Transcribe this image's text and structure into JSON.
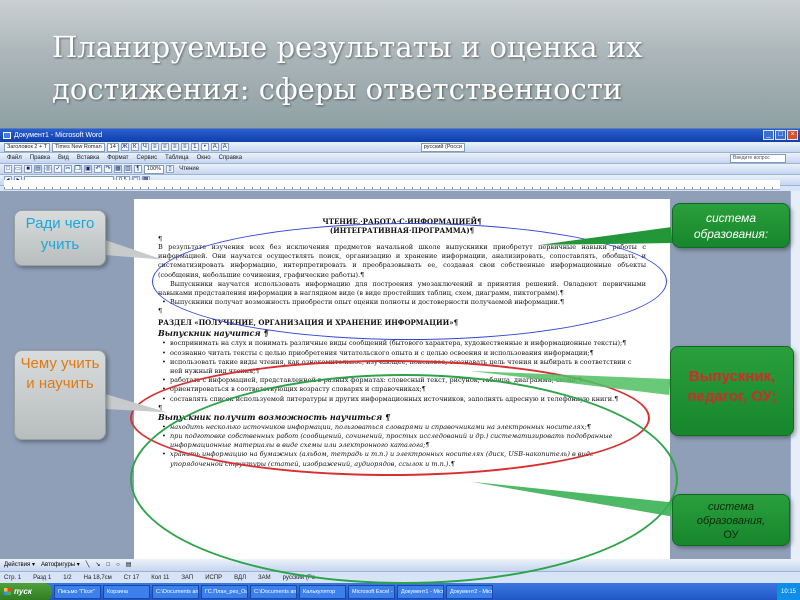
{
  "slide": {
    "title": "Планируемые результаты и оценка их достижения: сферы ответственности"
  },
  "word": {
    "window_title": "Документ1 - Microsoft Word",
    "style": "Заголовок 2 + Т",
    "font": "Times New Roman",
    "font_size": "14",
    "language": "русский (Росси",
    "zoom": "100%",
    "reading_label": "Чтение",
    "help_placeholder": "Введите вопрос",
    "indent_value": "0,5",
    "menu": [
      "Файл",
      "Правка",
      "Вид",
      "Вставка",
      "Формат",
      "Сервис",
      "Таблица",
      "Окно",
      "Справка"
    ],
    "document": {
      "heading_1": "ЧТЕНИЕ.·РАБОТА·С·ИНФОРМАЦИЕЙ¶",
      "heading_2": "(ИНТЕГРАТИВНАЯ·ПРОГРАММА)¶",
      "para_1": "В результате изучения всех без исключения предметов начальной школе выпускники приобретут первичные навыки работы с информацией. Они научатся осуществлять поиск, организацию и хранение информации, анализировать, сопоставлять, обобщать, и систематизировать информацию, интерпретировать и преобразовывать ее, создавая свои собственные информационные объекты (сообщения, небольшие сочинения, графические работы).¶",
      "para_2": "Выпускники научатся использовать информацию для построения умозаключений и принятия решений. Овладеют первичными навыками представления информации в наглядном виде (в виде простейших таблиц, схем, диаграмм, пиктограмм).¶",
      "para_3": "Выпускники получат возможность приобрести опыт оценки полноты и достоверности получаемой информации.¶",
      "section": "РАЗДЕЛ «ПОЛУЧЕНИЕ, ОРГАНИЗАЦИЯ И ХРАНЕНИЕ ИНФОРМАЦИИ»¶",
      "sub_1": "Выпускник научится ¶",
      "bullets_1": [
        "воспринимать на слух и понимать различные виды сообщений (бытового характера, художественные и информационные тексты);¶",
        "осознанно читать тексты с целью приобретения читательского опыта и с целью освоения и использования информации;¶",
        "использовать такие виды чтения, как ознакомительное, изучающее, поисковое, осознавать цель чтения и выбирать в соответствии с ней нужный вид чтения;¶",
        "работать с информацией, представленной в разных форматах: словесный текст, рисунок, таблица, диаграмма, схема;¶",
        "ориентироваться в соответствующих возрасту словарях и справочниках;¶",
        "составлять список используемой литературы и других информационных источников, заполнять адресную и телефонную книги.¶"
      ],
      "sub_2": "Выпускник получит возможность научиться ¶",
      "bullets_2": [
        "находить несколько источников информации, пользоваться словарями и справочниками на электронных носителях;¶",
        "при подготовке собственных работ (сообщений, сочинений, простых исследований и др.) систематизировать подобранные информационные материалы в виде схемы или электронного каталога;¶",
        "хранить информацию на бумажных (альбом, тетрадь и т.п.) и электронных носителях (диск, USB-накопитель) в виде упорядоченной структуры (статей, изображений, аудиорядов, ссылок и т.п.).¶"
      ]
    },
    "drawbar": [
      "Действия ▾",
      "Автофигуры ▾"
    ],
    "status": [
      "Стр. 1",
      "Разд 1",
      "1/2",
      "На 18,7см",
      "Ст 17",
      "Кол 11",
      "ЗАП",
      "ИСПР",
      "ВДЛ",
      "ЗАМ",
      "русский (Ро"
    ]
  },
  "taskbar": {
    "start": "пуск",
    "items": [
      "Письмо \"Поэт\"",
      "Корзина",
      "C:\\Documents and",
      "ГС.План_рез_Оцен",
      "C:\\Documents and",
      "Калькулятор",
      "Microsoft Excel - 01",
      "Документ1 - Micros",
      "Документ2 - Micros"
    ],
    "clock": "10:15"
  },
  "callouts": {
    "why": "Ради чего учить",
    "what": "Чему учить и научить",
    "system": "система образования:",
    "graduate": "Выпускник, педагог, ОУ;",
    "system_school": "система образования,",
    "school": "ОУ"
  },
  "colors": {
    "blue_ellipse": "#2f46d8",
    "red_ellipse": "#d83030",
    "green_ellipse": "#2ea44a",
    "callout_green": "#17862c",
    "why_text": "#1aa8d8",
    "what_text": "#e07a10",
    "graduate_text": "#d22a2a"
  }
}
